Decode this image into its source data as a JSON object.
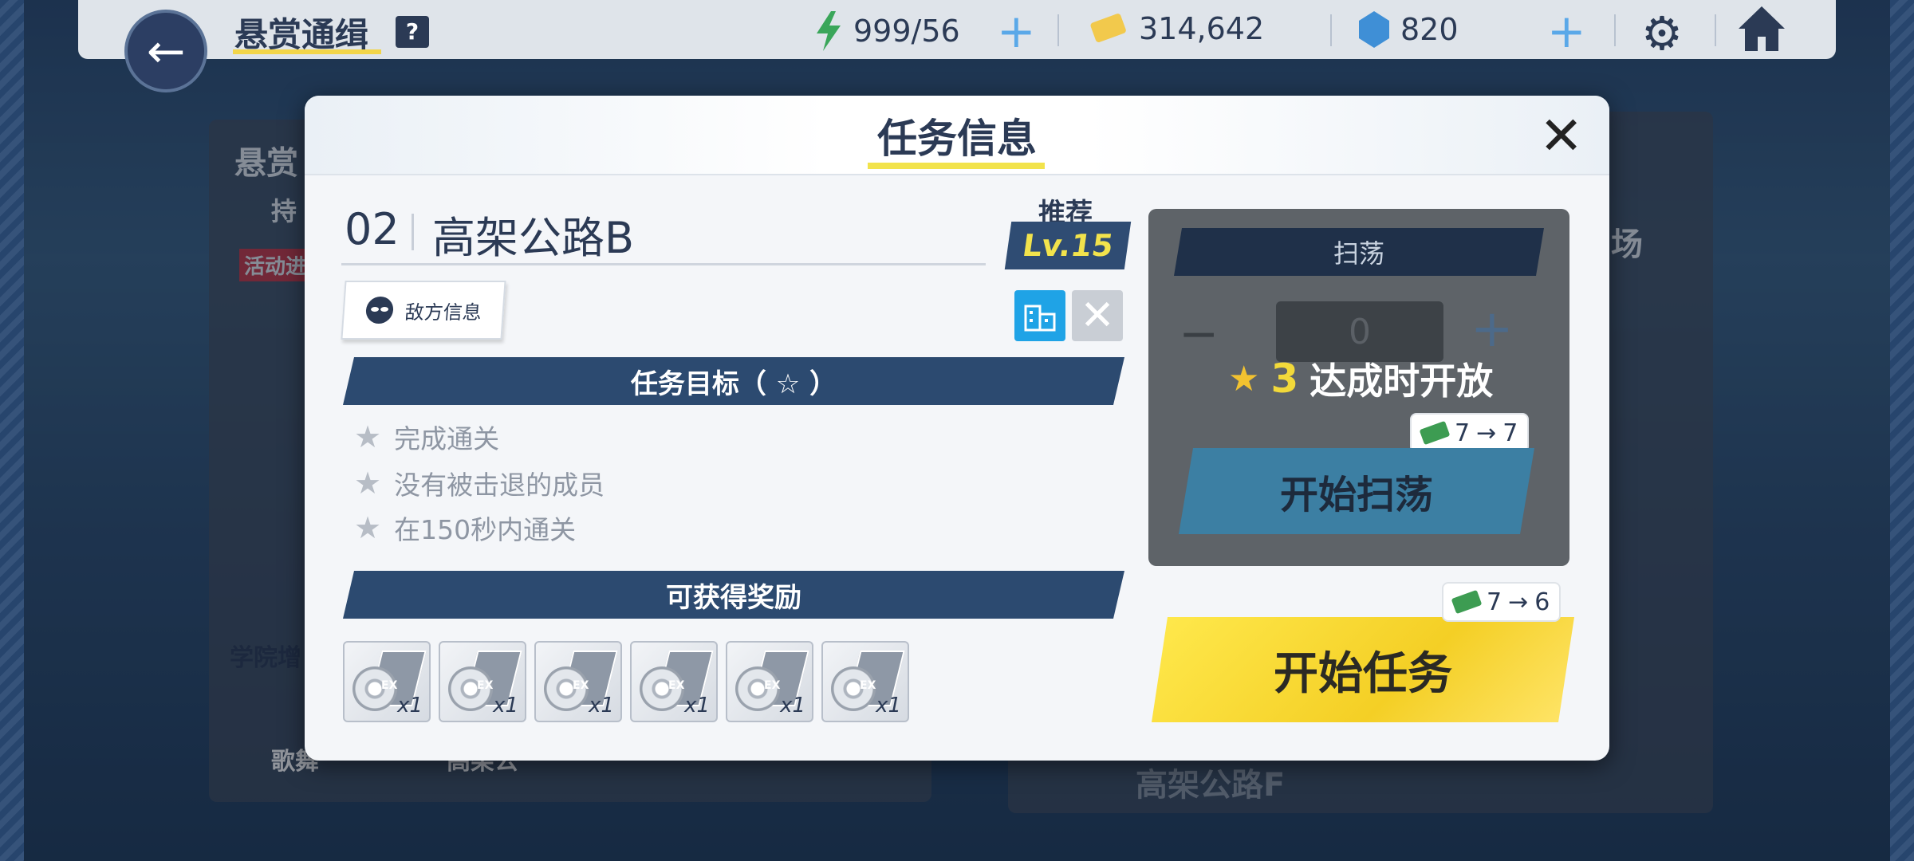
{
  "header": {
    "title": "悬赏通缉",
    "help_label": "?",
    "energy": "999/56",
    "credits": "314,642",
    "gems": "820"
  },
  "background": {
    "card_title": "悬赏",
    "card_sub": "持",
    "event_badge": "活动进",
    "academy_label": "学院增",
    "stage_label_right": "场",
    "bottom_stage": "高架公路F",
    "bottom_left_1": "歌舞",
    "bottom_left_2": "高架公"
  },
  "modal": {
    "title": "任务信息",
    "close_label": "✕",
    "stage_number": "02",
    "stage_name": "高架公路B",
    "recommend_label": "推荐",
    "recommend_level": "Lv.15",
    "enemy_info_label": "敌方信息",
    "objectives_header": "任务目标（ ☆ ）",
    "objectives": [
      "完成通关",
      "没有被击退的成员",
      "在150秒内通关"
    ],
    "rewards_header": "可获得奖励",
    "rewards": [
      {
        "qty": "x1"
      },
      {
        "qty": "x1"
      },
      {
        "qty": "x1"
      },
      {
        "qty": "x1"
      },
      {
        "qty": "x1"
      },
      {
        "qty": "x1"
      }
    ],
    "reward_tag": "EX"
  },
  "sweep": {
    "header": "扫荡",
    "count": "0",
    "lock_star_count": "3",
    "lock_text": "达成时开放",
    "cost_from": "7",
    "cost_to": "7",
    "button_label": "开始扫荡"
  },
  "start": {
    "cost_from": "7",
    "cost_to": "6",
    "button_label": "开始任务"
  },
  "colors": {
    "accent_yellow": "#f2d93a",
    "navy": "#2c4a70",
    "city_blue": "#1fa3e6"
  }
}
